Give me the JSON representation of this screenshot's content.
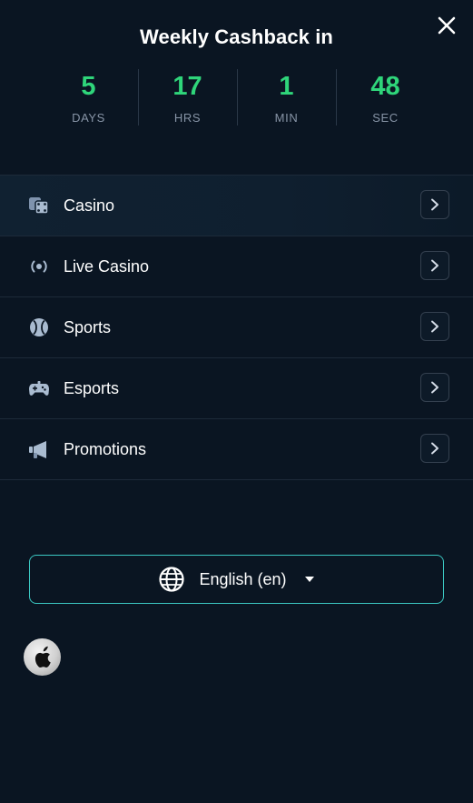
{
  "header": {
    "title": "Weekly Cashback in",
    "close_icon": "close-icon"
  },
  "countdown": [
    {
      "value": "5",
      "label": "DAYS"
    },
    {
      "value": "17",
      "label": "HRS"
    },
    {
      "value": "1",
      "label": "MIN"
    },
    {
      "value": "48",
      "label": "SEC"
    }
  ],
  "menu": {
    "items": [
      {
        "label": "Casino",
        "icon": "dice-icon"
      },
      {
        "label": "Live Casino",
        "icon": "broadcast-icon"
      },
      {
        "label": "Sports",
        "icon": "ball-icon"
      },
      {
        "label": "Esports",
        "icon": "gamepad-icon"
      },
      {
        "label": "Promotions",
        "icon": "megaphone-icon"
      }
    ]
  },
  "language": {
    "label": "English (en)",
    "icon": "globe-icon"
  },
  "app_download": {
    "icon": "apple-icon"
  },
  "colors": {
    "background": "#0a1522",
    "countdown_value": "#2fd57a",
    "language_border": "#3bc7c2"
  }
}
